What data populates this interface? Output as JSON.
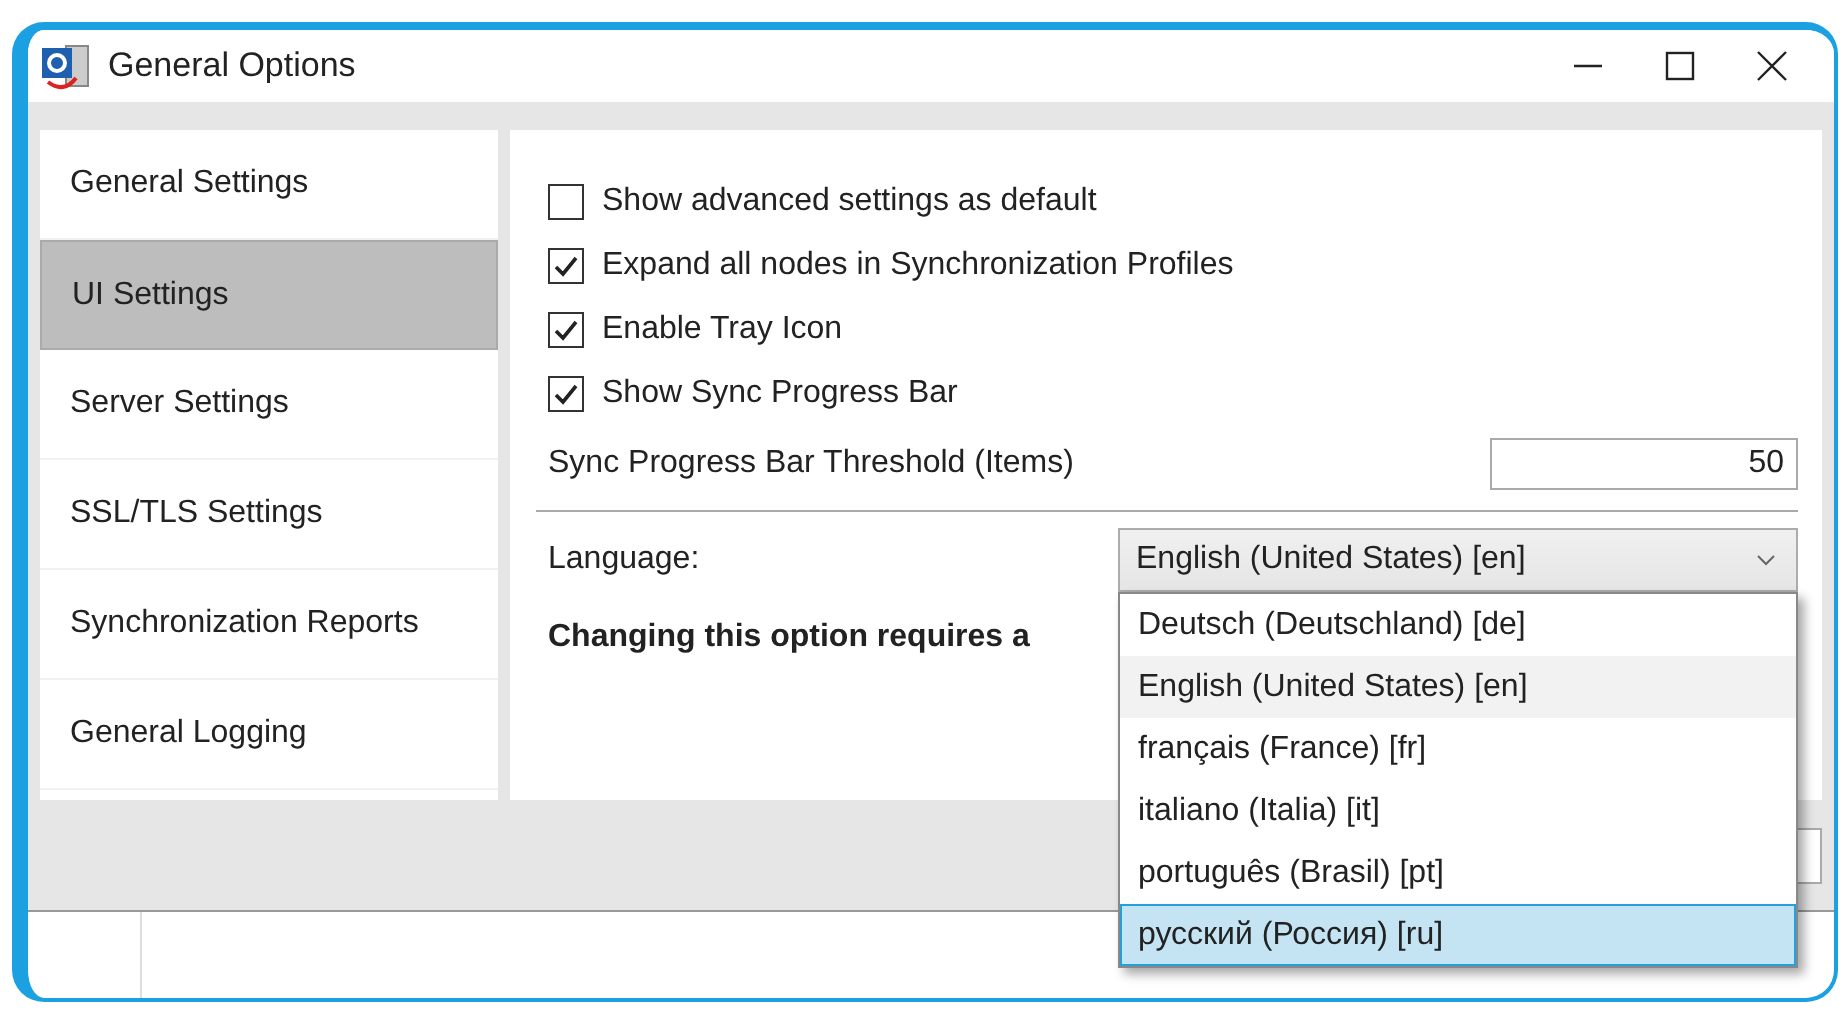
{
  "window": {
    "title": "General Options"
  },
  "sidebar": {
    "items": [
      {
        "label": "General Settings",
        "selected": false
      },
      {
        "label": "UI Settings",
        "selected": true
      },
      {
        "label": "Server Settings",
        "selected": false
      },
      {
        "label": "SSL/TLS Settings",
        "selected": false
      },
      {
        "label": "Synchronization Reports",
        "selected": false
      },
      {
        "label": "General Logging",
        "selected": false
      }
    ]
  },
  "checkboxes": [
    {
      "label": "Show advanced settings as default",
      "checked": false
    },
    {
      "label": "Expand all nodes in Synchronization Profiles",
      "checked": true
    },
    {
      "label": "Enable Tray Icon",
      "checked": true
    },
    {
      "label": "Show Sync Progress Bar",
      "checked": true
    }
  ],
  "threshold": {
    "label": "Sync Progress Bar Threshold (Items)",
    "value": "50"
  },
  "language": {
    "label": "Language:",
    "value": "English (United States) [en]",
    "expanded": true,
    "options": [
      {
        "label": "Deutsch (Deutschland) [de]",
        "selected": false,
        "hovered": false
      },
      {
        "label": "English (United States) [en]",
        "selected": true,
        "hovered": false
      },
      {
        "label": "français (France) [fr]",
        "selected": false,
        "hovered": false
      },
      {
        "label": "italiano (Italia) [it]",
        "selected": false,
        "hovered": false
      },
      {
        "label": "português (Brasil) [pt]",
        "selected": false,
        "hovered": false
      },
      {
        "label": "русский (Россия) [ru]",
        "selected": false,
        "hovered": true
      }
    ]
  },
  "note": "Changing this option requires a"
}
